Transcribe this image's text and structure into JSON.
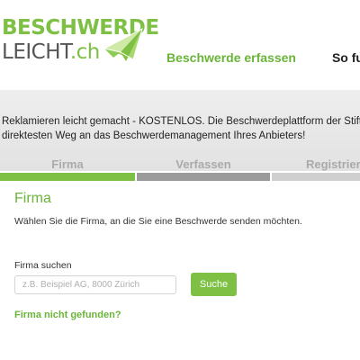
{
  "logo": {
    "line1": "BESCHWERDE",
    "line2_main": "LEICHT",
    "line2_tld": ".ch",
    "icon": "paper-plane-icon",
    "brand_color": "#7dc043"
  },
  "nav": {
    "items": [
      {
        "label": "Beschwerde erfassen"
      },
      {
        "label": "So fun"
      }
    ],
    "active_color": "#6ab43a"
  },
  "intro": {
    "line1": "Reklamieren leicht gemacht - KOSTENLOS. Die Beschwerdeplattform der Stiftu",
    "line2": "direktesten Weg an das Beschwerdemanagement Ihres Anbieters!"
  },
  "steps": [
    {
      "label": "Firma",
      "state": "active"
    },
    {
      "label": "Verfassen",
      "state": "pending"
    },
    {
      "label": "Registriere",
      "state": "pending"
    }
  ],
  "form": {
    "title": "Firma",
    "description": "Wählen Sie die Firma, an die Sie eine Beschwerde senden möchten.",
    "search_label": "Firma suchen",
    "search_placeholder": "z.B. Beispiel AG, 8000 Zürich",
    "search_value": "",
    "search_button": "Suche",
    "not_found_link": "Firma nicht gefunden?"
  }
}
